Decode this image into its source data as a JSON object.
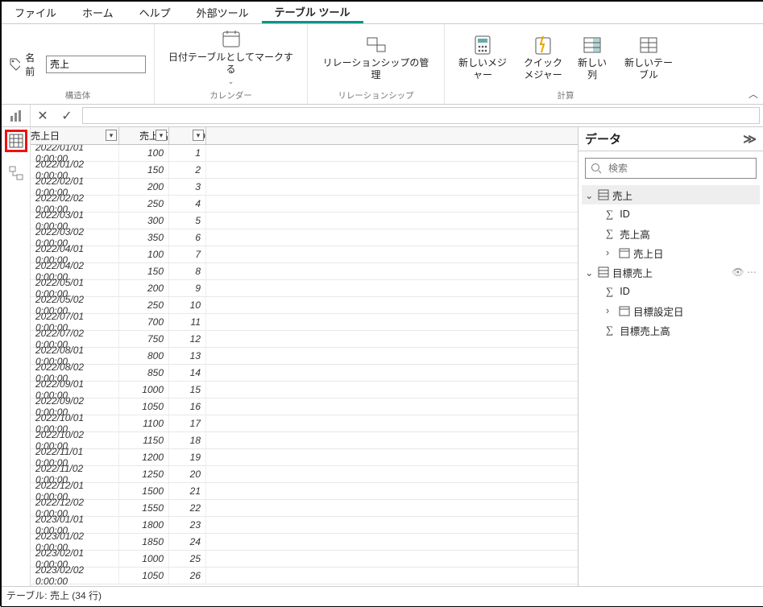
{
  "menu": {
    "items": [
      "ファイル",
      "ホーム",
      "ヘルプ",
      "外部ツール",
      "テーブル ツール"
    ],
    "active": 4
  },
  "ribbon": {
    "name_label": "名前",
    "name_value": "売上",
    "grp1": {
      "btn": "日付テーブルとしてマークする",
      "label": "カレンダー"
    },
    "grp2": {
      "btn": "リレーションシップの管理",
      "label": "リレーションシップ"
    },
    "grp3": {
      "b1": "新しいメジャー",
      "b2": "クイック\nメジャー",
      "b3": "新しい列",
      "b4": "新しいテーブル",
      "label": "計算"
    },
    "grp0_label": "構造体"
  },
  "grid": {
    "columns": [
      "売上日",
      "売上高",
      "ID"
    ],
    "rows": [
      [
        "2022/01/01 0:00:00",
        "100",
        "1"
      ],
      [
        "2022/01/02 0:00:00",
        "150",
        "2"
      ],
      [
        "2022/02/01 0:00:00",
        "200",
        "3"
      ],
      [
        "2022/02/02 0:00:00",
        "250",
        "4"
      ],
      [
        "2022/03/01 0:00:00",
        "300",
        "5"
      ],
      [
        "2022/03/02 0:00:00",
        "350",
        "6"
      ],
      [
        "2022/04/01 0:00:00",
        "100",
        "7"
      ],
      [
        "2022/04/02 0:00:00",
        "150",
        "8"
      ],
      [
        "2022/05/01 0:00:00",
        "200",
        "9"
      ],
      [
        "2022/05/02 0:00:00",
        "250",
        "10"
      ],
      [
        "2022/07/01 0:00:00",
        "700",
        "11"
      ],
      [
        "2022/07/02 0:00:00",
        "750",
        "12"
      ],
      [
        "2022/08/01 0:00:00",
        "800",
        "13"
      ],
      [
        "2022/08/02 0:00:00",
        "850",
        "14"
      ],
      [
        "2022/09/01 0:00:00",
        "1000",
        "15"
      ],
      [
        "2022/09/02 0:00:00",
        "1050",
        "16"
      ],
      [
        "2022/10/01 0:00:00",
        "1100",
        "17"
      ],
      [
        "2022/10/02 0:00:00",
        "1150",
        "18"
      ],
      [
        "2022/11/01 0:00:00",
        "1200",
        "19"
      ],
      [
        "2022/11/02 0:00:00",
        "1250",
        "20"
      ],
      [
        "2022/12/01 0:00:00",
        "1500",
        "21"
      ],
      [
        "2022/12/02 0:00:00",
        "1550",
        "22"
      ],
      [
        "2023/01/01 0:00:00",
        "1800",
        "23"
      ],
      [
        "2023/01/02 0:00:00",
        "1850",
        "24"
      ],
      [
        "2023/02/01 0:00:00",
        "1000",
        "25"
      ],
      [
        "2023/02/02 0:00:00",
        "1050",
        "26"
      ]
    ]
  },
  "panel": {
    "title": "データ",
    "search_ph": "検索",
    "t1": "売上",
    "t1_f1": "ID",
    "t1_f2": "売上高",
    "t1_f3": "売上日",
    "t2": "目標売上",
    "t2_f1": "ID",
    "t2_f2": "目標設定日",
    "t2_f3": "目標売上高"
  },
  "status": "テーブル: 売上 (34 行)"
}
